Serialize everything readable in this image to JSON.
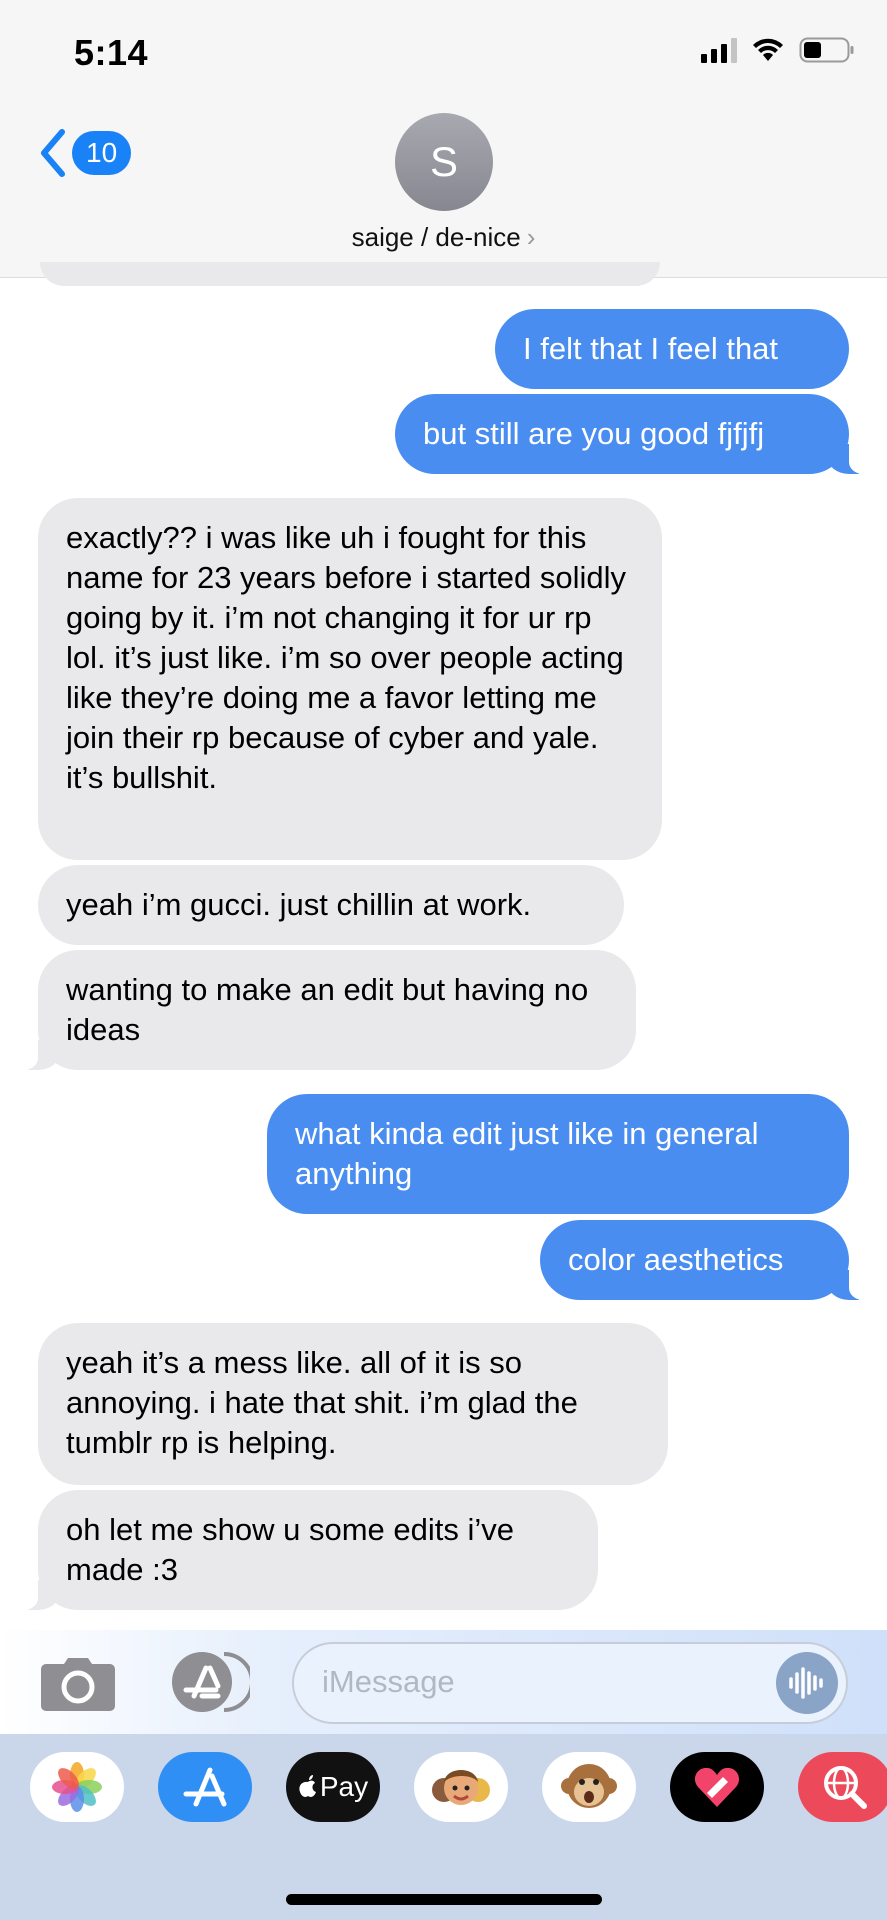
{
  "status_bar": {
    "time": "5:14"
  },
  "header": {
    "back_count": "10",
    "avatar_initial": "S",
    "contact_name": "saige / de-nice",
    "contact_chevron": "›"
  },
  "messages": [
    {
      "from": "me",
      "text": "I felt that I feel that"
    },
    {
      "from": "me",
      "text": "but still are you good fjfjfj"
    },
    {
      "from": "them",
      "text": "exactly?? i was like uh i fought for this name for 23 years before i started solidly going by it. i’m not changing it for ur rp lol. it’s just like. i’m so over people acting like they’re doing me a favor letting me join their rp because of cyber and yale. it’s bullshit."
    },
    {
      "from": "them",
      "text": "yeah i’m gucci. just chillin at work."
    },
    {
      "from": "them",
      "text": "wanting to make an edit but having no ideas"
    },
    {
      "from": "me",
      "text": "what kinda edit just like in general anything"
    },
    {
      "from": "me",
      "text": "color aesthetics"
    },
    {
      "from": "them",
      "text": "yeah it’s a mess like. all of it is so annoying. i hate that shit. i’m glad the tumblr rp is helping."
    },
    {
      "from": "them",
      "text": "oh let me show u some edits i’ve made :3"
    }
  ],
  "input": {
    "placeholder": "iMessage"
  },
  "app_drawer": {
    "apps": [
      {
        "icon": "photos-icon"
      },
      {
        "icon": "app-store-icon"
      },
      {
        "icon": "apple-pay-icon",
        "label": "Pay"
      },
      {
        "icon": "memoji-icon"
      },
      {
        "icon": "animoji-monkey-icon"
      },
      {
        "icon": "digital-touch-icon"
      },
      {
        "icon": "web-search-icon"
      }
    ]
  },
  "colors": {
    "sent": "#4a8df1",
    "received": "#e9e9eb",
    "accent": "#1a82f7"
  }
}
